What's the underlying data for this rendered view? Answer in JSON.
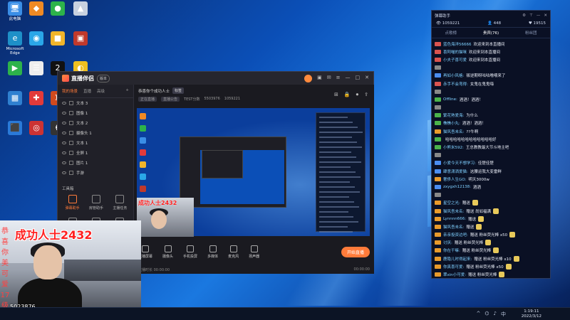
{
  "desktop": {
    "icons": [
      {
        "label": "此电脑",
        "color": "#3a8ee6",
        "glyph": "🖥"
      },
      {
        "label": "",
        "color": "#f08a24",
        "glyph": "◆"
      },
      {
        "label": "",
        "color": "#2db34a",
        "glyph": "●"
      },
      {
        "label": "",
        "color": "#c7d1e0",
        "glyph": "▲"
      },
      {
        "label": "Microsoft Edge",
        "color": "#1e90c8",
        "glyph": "e"
      },
      {
        "label": "",
        "color": "#2aa7e8",
        "glyph": "◉"
      },
      {
        "label": "",
        "color": "#f1b52a",
        "glyph": "■"
      },
      {
        "label": "",
        "color": "#c0392b",
        "glyph": "▣"
      },
      {
        "label": "",
        "color": "#2db34a",
        "glyph": "▶"
      },
      {
        "label": "",
        "color": "#eeeeee",
        "glyph": "☰"
      },
      {
        "label": "",
        "color": "#111111",
        "glyph": "2"
      },
      {
        "label": "",
        "color": "#f0c020",
        "glyph": "◐"
      },
      {
        "label": "",
        "color": "#2f80d0",
        "glyph": "▦"
      },
      {
        "label": "",
        "color": "#e23a3a",
        "glyph": "✚"
      },
      {
        "label": "",
        "color": "#d04a1e",
        "glyph": "♜"
      },
      {
        "label": "",
        "color": "#222222",
        "glyph": "✦"
      },
      {
        "label": "",
        "color": "#2a7ad8",
        "glyph": "⬛"
      },
      {
        "label": "",
        "color": "#cc3333",
        "glyph": "◎"
      },
      {
        "label": "",
        "color": "#333333",
        "glyph": "♞"
      },
      {
        "label": "",
        "color": "#e23a3a",
        "glyph": "◍"
      }
    ]
  },
  "taskbar": {
    "time": "1:19:11",
    "date": "2022/3/12"
  },
  "app": {
    "name": "直播伴侣",
    "version_label": "版本",
    "left_tabs": [
      "我的场景",
      "直播",
      "高级"
    ],
    "layers": [
      "文本 3",
      "图像 1",
      "文本 2",
      "摄像头 1",
      "文本 1",
      "全屏 1",
      "图片 1",
      "手游"
    ],
    "tools_heading": "工具箱",
    "tools": [
      "弹幕助手",
      "房管助手",
      "主播任务",
      "",
      "",
      ""
    ],
    "room_title": "恭喜你个成功人士",
    "room_tag": "标签",
    "room_sub": [
      "正在直播",
      "直播公告",
      "TEST分数",
      "5503976",
      "1059221"
    ],
    "bottom_items": [
      "直播屏幕",
      "摄像头",
      "手机投屏",
      "多媒体",
      "麦克风",
      "扬声器"
    ],
    "start_label": "开始直播",
    "status_left": "直播时长 00:00:00",
    "status_right": "00:00:00"
  },
  "cam": {
    "title": "成功人士2432",
    "vertical_text": [
      "恭",
      "喜",
      "你",
      "美",
      "可",
      "爱",
      "17",
      "级"
    ],
    "id_text": "5023876",
    "mini_title": "成功人士2432"
  },
  "chat": {
    "title": "弹幕助手",
    "stats": [
      "1059221",
      "448",
      "19515"
    ],
    "tabs": [
      "点歌榜",
      "贵宾(76)",
      "粉丝团"
    ],
    "messages": [
      {
        "user": "蓝色海洋56666",
        "text": "欢迎来到本直播间",
        "badge": "#d9534f"
      },
      {
        "user": "喜阿喵的猫咪",
        "text": "欢迎来到本直播间",
        "badge": "#d9534f"
      },
      {
        "user": "小夫子喜可爱",
        "text": "欢迎来到本直播间",
        "badge": "#d9534f"
      },
      {
        "user": "",
        "text": "",
        "badge": "#888"
      },
      {
        "user": "再如小风格:",
        "text": "叛逆期呀咕咕噜喂来了",
        "badge": "#4b8df0"
      },
      {
        "user": "赤手不会弯得:",
        "text": "女鬼在鬼鬼嗨",
        "badge": "#d9534f"
      },
      {
        "user": "",
        "text": "",
        "badge": "#888"
      },
      {
        "user": "Offline:",
        "text": "酒酒！酒酒！",
        "badge": "#4bb34b"
      },
      {
        "user": "",
        "text": "",
        "badge": "#888"
      },
      {
        "user": "繁花熟爱海:",
        "text": "为什么",
        "badge": "#4bb34b"
      },
      {
        "user": "樵樵小丸:",
        "text": "酒酒！酒酒！",
        "badge": "#4bb34b"
      },
      {
        "user": "猫风吾未名:",
        "text": "??牛啊",
        "badge": "#e89a2b"
      },
      {
        "user": "",
        "text": "哈哈哈哈哈哈哈哈哈哈哈哈好",
        "badge": "#4bb34b"
      },
      {
        "user": "小熊米592:",
        "text": "王总教教最大节斗地主吧",
        "badge": "#4bb34b"
      },
      {
        "user": "",
        "text": "",
        "badge": "#888"
      },
      {
        "user": "小爱今天不想学习:",
        "text": "佳楚佳楚",
        "badge": "#4b8df0"
      },
      {
        "user": "肆意潇洒爱猫:",
        "text": "这腰运我大变雷鲜",
        "badge": "#4b8df0"
      },
      {
        "user": "奢侈人生GO:",
        "text": "明天3000w",
        "badge": "#e89a2b"
      },
      {
        "user": "zxygxh12138:",
        "text": "酒酒",
        "badge": "#4b8df0"
      },
      {
        "user": "",
        "text": "",
        "badge": "#888"
      },
      {
        "user": "星空之光:",
        "text": "赠送",
        "badge": "#e89a2b"
      },
      {
        "user": "猫风吾未名:",
        "text": "赠送 尚如福满",
        "badge": "#e89a2b"
      },
      {
        "user": "Lynnnn666:",
        "text": "赠送",
        "badge": "#e89a2b"
      },
      {
        "user": "猫风吾未名:",
        "text": "赠送",
        "badge": "#e89a2b"
      },
      {
        "user": "亲亲投资边吧:",
        "text": "赠送 粉丝荧光棒 x50",
        "badge": "#e89a2b"
      },
      {
        "user": "讨厌:",
        "text": "赠送 粉丝荧光棒",
        "badge": "#e89a2b"
      },
      {
        "user": "你在干嘛:",
        "text": "赠送 粉丝荧光棒",
        "badge": "#e89a2b"
      },
      {
        "user": "鹿隐儿时得起来:",
        "text": "赠送 粉丝荧光棒 x10",
        "badge": "#e89a2b"
      },
      {
        "user": "你真喜可爱:",
        "text": "赠送 粉丝荧光棒 x50",
        "badge": "#e89a2b"
      },
      {
        "user": "翠xin小可爱:",
        "text": "赠送 粉丝荧光棒",
        "badge": "#e89a2b"
      }
    ]
  }
}
